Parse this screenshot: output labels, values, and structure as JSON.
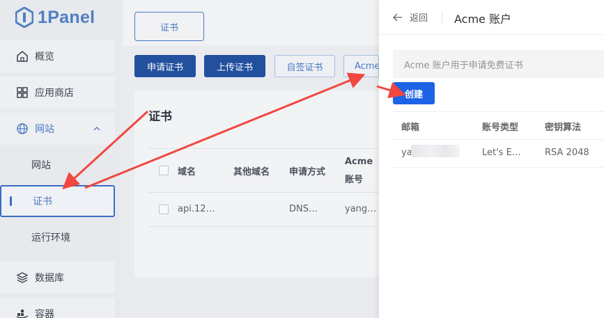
{
  "app": {
    "logo_text": "1Panel"
  },
  "sidebar": {
    "overview": "概览",
    "app_store": "应用商店",
    "website_group": "网站",
    "website": "网站",
    "certificate": "证书",
    "runtime": "运行环境",
    "database": "数据库",
    "container": "容器"
  },
  "main": {
    "tab_label": "证书",
    "buttons": {
      "apply": "申请证书",
      "upload": "上传证书",
      "self_signed": "自签证书",
      "acme": "Acme"
    },
    "card_title": "证书",
    "table": {
      "headers": {
        "domain": "域名",
        "other_domains": "其他域名",
        "apply_method": "申请方式",
        "acme_account_l1": "Acme",
        "acme_account_l2": "账号"
      },
      "row": {
        "domain": "api.12…",
        "apply_method": "DNS…",
        "acme_account": "yang…"
      }
    }
  },
  "drawer": {
    "back_label": "返回",
    "title": "Acme 账户",
    "alert_text": "Acme 账户用于申请免费证书",
    "create_label": "创建",
    "table": {
      "headers": {
        "email": "邮箱",
        "account_type": "账号类型",
        "key_algorithm": "密钥算法"
      },
      "row": {
        "email": "ya",
        "account_type": "Let's E…",
        "key_algorithm": "RSA 2048"
      }
    }
  },
  "colors": {
    "primary": "#1d63e6",
    "annotation_arrow": "#f0473f",
    "sidebar_accent": "#3a6dc4"
  },
  "icons": [
    "home-icon",
    "app-store-icon",
    "globe-icon",
    "chevron-up-icon",
    "database-icon",
    "container-icon",
    "back-arrow-icon"
  ]
}
